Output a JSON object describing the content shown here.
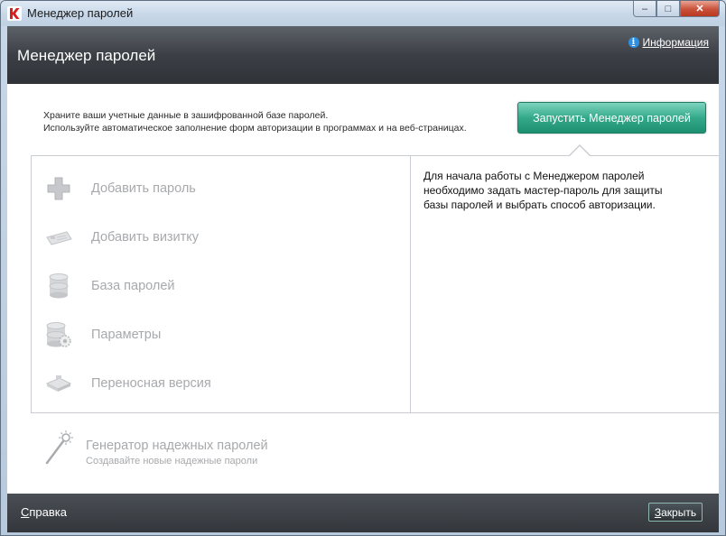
{
  "window": {
    "title": "Менеджер паролей",
    "controls": {
      "minimize": "–",
      "maximize": "□",
      "close": "✕"
    }
  },
  "header": {
    "title": "Менеджер паролей",
    "info_icon": "i",
    "info_link": "Информация"
  },
  "intro": {
    "line1": "Храните ваши учетные данные в зашифрованной базе паролей.",
    "line2": "Используйте автоматическое заполнение форм авторизации в программах и на веб-страницах."
  },
  "launch_button": "Запустить Менеджер паролей",
  "menu": {
    "items": [
      {
        "label": "Добавить пароль",
        "icon": "plus-icon"
      },
      {
        "label": "Добавить визитку",
        "icon": "business-card-icon"
      },
      {
        "label": "База паролей",
        "icon": "database-icon"
      },
      {
        "label": "Параметры",
        "icon": "database-settings-icon"
      },
      {
        "label": "Переносная версия",
        "icon": "portable-drive-icon"
      }
    ]
  },
  "info_text": {
    "line1": "Для начала работы с Менеджером паролей",
    "line2": "необходимо задать мастер-пароль для защиты",
    "line3": "базы паролей и выбрать способ авторизации."
  },
  "generator": {
    "title": "Генератор надежных паролей",
    "subtitle": "Создавайте новые надежные пароли"
  },
  "footer": {
    "help": "Справка",
    "close": "Закрыть"
  },
  "colors": {
    "launch_button": "#34a98a",
    "header_bg": "#3c4046",
    "disabled_text": "#a7a9ac"
  }
}
